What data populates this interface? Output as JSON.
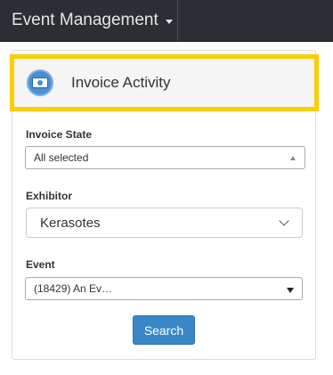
{
  "navbar": {
    "menu_label": "Event Management"
  },
  "panel": {
    "title": "Invoice Activity",
    "icon": "money-icon"
  },
  "form": {
    "invoice_state": {
      "label": "Invoice State",
      "value": "All selected"
    },
    "exhibitor": {
      "label": "Exhibitor",
      "value": "Kerasotes"
    },
    "event": {
      "label": "Event",
      "value": "(18429) An Ev…"
    },
    "search_label": "Search"
  },
  "colors": {
    "highlight": "#ffcc00",
    "primary": "#3a87c8",
    "navbar": "#2b2f33"
  }
}
